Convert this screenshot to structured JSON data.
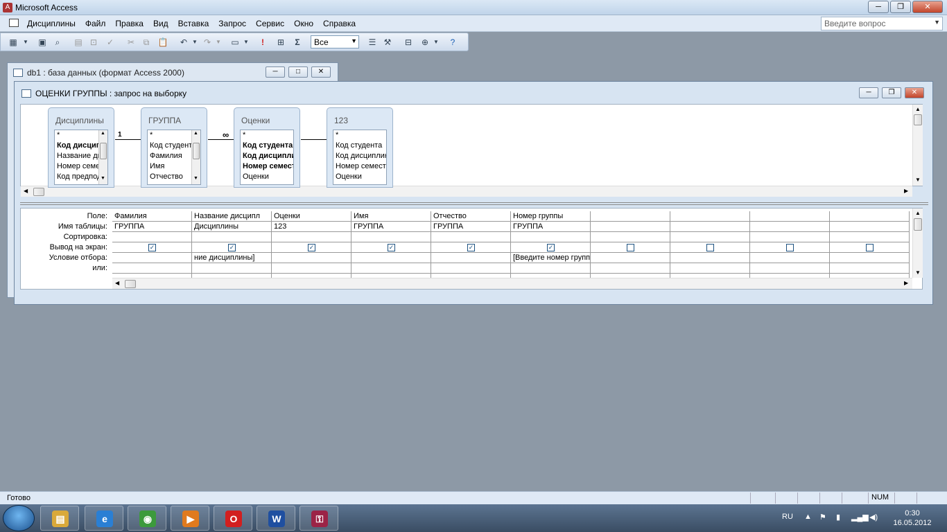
{
  "app": {
    "title": "Microsoft Access"
  },
  "menu": [
    "Дисциплины",
    "Файл",
    "Правка",
    "Вид",
    "Вставка",
    "Запрос",
    "Сервис",
    "Окно",
    "Справка"
  ],
  "help": {
    "placeholder": "Введите вопрос"
  },
  "toolbar": {
    "filter_value": "Все",
    "sum_icon": "Σ",
    "run_icon": "!"
  },
  "db_window": {
    "title": "db1 : база данных (формат Access 2000)"
  },
  "query_window": {
    "title": "ОЦЕНКИ ГРУППЫ : запрос на выборку"
  },
  "field_lists": [
    {
      "title": "Дисциплины",
      "fields": [
        {
          "t": "*",
          "b": false
        },
        {
          "t": "Код дисциплины",
          "b": true
        },
        {
          "t": "Название дисциплины",
          "b": false
        },
        {
          "t": "Номер семестра",
          "b": false
        },
        {
          "t": "Код предподавателя",
          "b": false
        }
      ]
    },
    {
      "title": "ГРУППА",
      "fields": [
        {
          "t": "*",
          "b": false
        },
        {
          "t": "Код студента",
          "b": false
        },
        {
          "t": "Фамилия",
          "b": false
        },
        {
          "t": "Имя",
          "b": false
        },
        {
          "t": "Отчество",
          "b": false
        }
      ]
    },
    {
      "title": "Оценки",
      "fields": [
        {
          "t": "*",
          "b": false
        },
        {
          "t": "Код студента",
          "b": true
        },
        {
          "t": "Код дисциплины",
          "b": true
        },
        {
          "t": "Номер семестра",
          "b": true
        },
        {
          "t": "Оценки",
          "b": false
        }
      ]
    },
    {
      "title": "123",
      "fields": [
        {
          "t": "*",
          "b": false
        },
        {
          "t": "Код студента",
          "b": false
        },
        {
          "t": "Код дисциплины",
          "b": false
        },
        {
          "t": "Номер семестра",
          "b": false
        },
        {
          "t": "Оценки",
          "b": false
        }
      ]
    }
  ],
  "relations": {
    "one": "1",
    "many": "∞"
  },
  "grid": {
    "row_labels": [
      "Поле:",
      "Имя таблицы:",
      "Сортировка:",
      "Вывод на экран:",
      "Условие отбора:",
      "или:"
    ],
    "columns": [
      {
        "field": "Фамилия",
        "table": "ГРУППА",
        "sort": "",
        "show": true,
        "criteria": "",
        "or": ""
      },
      {
        "field": "Название дисципл",
        "table": "Дисциплины",
        "sort": "",
        "show": true,
        "criteria": "ние дисциплины]",
        "or": ""
      },
      {
        "field": "Оценки",
        "table": "123",
        "sort": "",
        "show": true,
        "criteria": "",
        "or": ""
      },
      {
        "field": "Имя",
        "table": "ГРУППА",
        "sort": "",
        "show": true,
        "criteria": "",
        "or": ""
      },
      {
        "field": "Отчество",
        "table": "ГРУППА",
        "sort": "",
        "show": true,
        "criteria": "",
        "or": ""
      },
      {
        "field": "Номер группы",
        "table": "ГРУППА",
        "sort": "",
        "show": true,
        "criteria": "[Введите номер групп",
        "or": ""
      },
      {
        "field": "",
        "table": "",
        "sort": "",
        "show": false,
        "criteria": "",
        "or": ""
      },
      {
        "field": "",
        "table": "",
        "sort": "",
        "show": false,
        "criteria": "",
        "or": ""
      },
      {
        "field": "",
        "table": "",
        "sort": "",
        "show": false,
        "criteria": "",
        "or": ""
      },
      {
        "field": "",
        "table": "",
        "sort": "",
        "show": false,
        "criteria": "",
        "or": ""
      }
    ]
  },
  "status": {
    "text": "Готово",
    "num": "NUM"
  },
  "tray": {
    "lang": "RU",
    "time": "0:30",
    "date": "16.05.2012"
  },
  "taskbar": [
    {
      "name": "explorer",
      "glyph": "▤",
      "color": "#d9a93a"
    },
    {
      "name": "ie",
      "glyph": "e",
      "color": "#2a7fd4"
    },
    {
      "name": "chrome",
      "glyph": "◉",
      "color": "#3c9a3c"
    },
    {
      "name": "media",
      "glyph": "▶",
      "color": "#e07a1e"
    },
    {
      "name": "opera",
      "glyph": "O",
      "color": "#d21f1f"
    },
    {
      "name": "word",
      "glyph": "W",
      "color": "#1f4fa0"
    },
    {
      "name": "access",
      "glyph": "⚿",
      "color": "#9b2346"
    }
  ]
}
